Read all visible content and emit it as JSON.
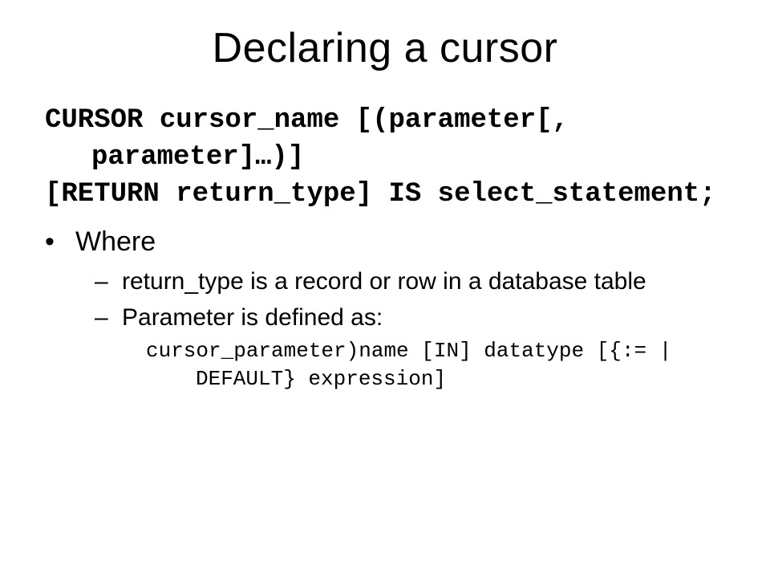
{
  "title": "Declaring a cursor",
  "syntax": {
    "line1": "CURSOR cursor_name [(parameter[, parameter]…)]",
    "line2": "[RETURN return_type] IS select_statement;"
  },
  "bullet": {
    "mark": "•",
    "label": "Where"
  },
  "subs": {
    "mark": "–",
    "item1": "return_type is a record or row in a database table",
    "item2": "Parameter is defined as:"
  },
  "paramCode": "cursor_parameter)name [IN] datatype [{:= | DEFAULT} expression]"
}
